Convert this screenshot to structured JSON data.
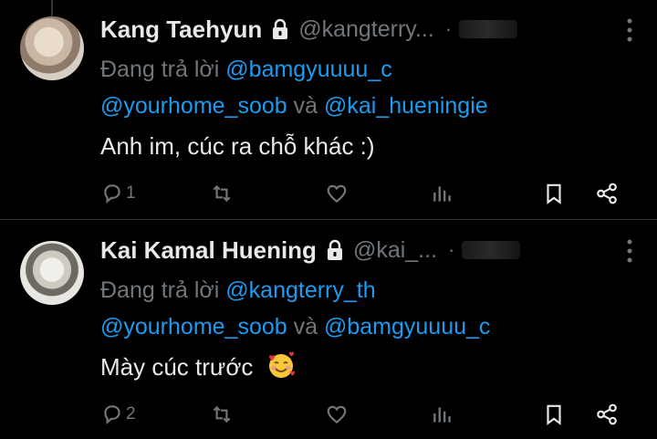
{
  "tweets": [
    {
      "name": "Kang Taehyun",
      "handle": "@kangterry...",
      "separator": "·",
      "replying_prefix": "Đang trả lời",
      "reply_to_1": "@bamgyuuuu_c",
      "reply_to_2": "@yourhome_soob",
      "and_word": "và",
      "reply_to_3": "@kai_hueningie",
      "text": "Anh im, cúc ra chỗ khác :)",
      "reply_count": "1"
    },
    {
      "name": "Kai Kamal Huening",
      "handle": "@kai_...",
      "separator": "·",
      "replying_prefix": "Đang trả lời",
      "reply_to_1": "@kangterry_th",
      "reply_to_2": "@yourhome_soob",
      "and_word": "và",
      "reply_to_3": "@bamgyuuuu_c",
      "text": "Mày cúc trước",
      "emoji": "smiling-face-with-hearts",
      "reply_count": "2"
    }
  ],
  "colors": {
    "background": "#000000",
    "text": "#e7e9ea",
    "muted": "#71767b",
    "link": "#1d9bf0"
  }
}
